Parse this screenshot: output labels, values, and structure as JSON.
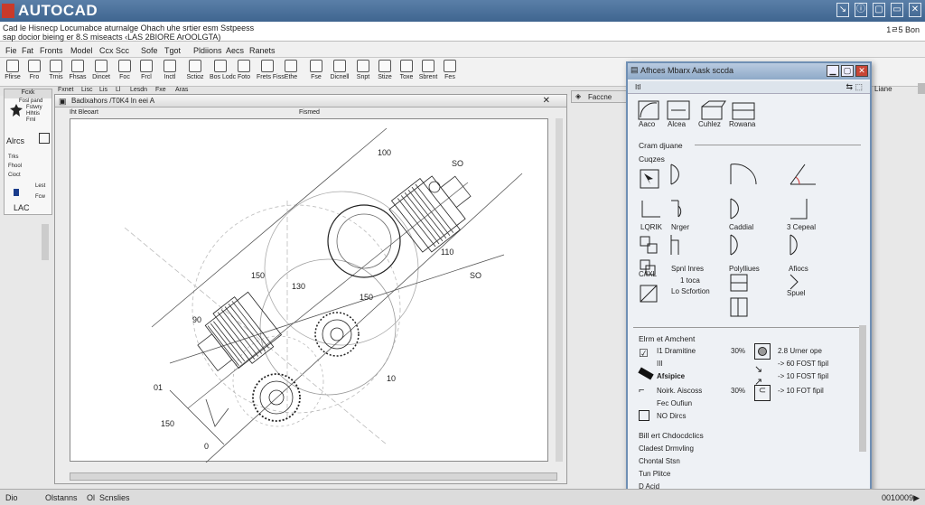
{
  "app": {
    "title": "AUTOCAD",
    "info_line1": "Cad le Hisnecp Locumabce aturnalge Ohach uhe srtier esm Sstpeess",
    "info_line2": "sap docior bieing er 8.S miseacts ‹LAS 2BIORE ArOOLGTA)",
    "info_right": "1ㄹ5 Bon"
  },
  "window_buttons": [
    "↘",
    "ⓘ",
    "▢",
    "▭",
    "✕"
  ],
  "menu": [
    "Fie",
    "Fat",
    "Fronts",
    "Model",
    "Ccx Scc",
    "Sofe",
    "Tgot",
    "Pldiions",
    "Aecs",
    "Ranets"
  ],
  "ribbon_tools": [
    "Ffirse",
    "Fro",
    "Trnis",
    "Fhsas",
    "Dincet",
    "Foc",
    "Frcl",
    "Inctl",
    "Sctioz",
    "Bos Lodc",
    "Foto",
    "Frets Fiss",
    "Ethe",
    "Fse",
    "Dicnell",
    "Snpt",
    "Stize",
    "Toxe",
    "Sbrent",
    "Fes"
  ],
  "subbar": [
    "Fxnet",
    "Lisc",
    "Lis",
    "Ll",
    "Lesdn",
    "Fxe",
    "Aras"
  ],
  "left_panel": {
    "header": "Fcxk",
    "items": [
      "Fosl pand",
      "Fstwry",
      "Hlhtis",
      "Frnl",
      "Alrcs",
      "Trks",
      "Fhool",
      "Cioct",
      "Lest",
      "Fcw",
      "LAC"
    ]
  },
  "canvas_window": {
    "title": "Badixahors /T0K4 ln eei A",
    "tab_left": "Iht Bleoart",
    "tab_model": "Fismed",
    "dims": [
      "100",
      "110",
      "SO",
      "SO",
      "150",
      "130",
      "150",
      "90",
      "01",
      "150",
      "0",
      "10"
    ]
  },
  "properties_bar": "Faccne",
  "right_tab": "Liane",
  "dialog": {
    "title": "Afhces Mbarx Aask sccda",
    "sub_label": "Itl",
    "sub_right": "⇆  ⬚",
    "top_icons": [
      "Aaco",
      "Alcea",
      "Cuhlez",
      "Rowana"
    ],
    "section1": "Cram djuane",
    "section2": "Cuqzes",
    "row1_labels": [
      "LQRIK",
      "Nrger",
      "Caddial",
      "3 Cepeal"
    ],
    "row2_labels": [
      "C/IXL",
      "Spnl Inres",
      "Polylliues",
      "Afiocs"
    ],
    "row3_labels": [
      "1 toca",
      "Lo Scfortion",
      "Spuel"
    ],
    "section3": "Elrm et Amchent",
    "attr_left": [
      "I1 Dramitine",
      "III",
      "Afsipice",
      "Noirk. Aiscoss",
      "Fec Oufiun",
      "NO Dircs"
    ],
    "attr_pct": [
      "30%",
      "30%"
    ],
    "attr_right": [
      "2.8 Urner ope",
      "-> 60 FOST fipil",
      "-> 10 FOST fipil",
      "-> 10 FOT fipil"
    ],
    "section4": "Bill ert Chdocdclics",
    "bottom_items": [
      "Cladest Drmvling",
      "Chontal Stsn",
      "Tun Plitce",
      "D Acid"
    ]
  },
  "statusbar": {
    "items": [
      "Dio",
      "Olstanns",
      "Ol",
      "Scnslies"
    ],
    "right": "0010009▶"
  }
}
